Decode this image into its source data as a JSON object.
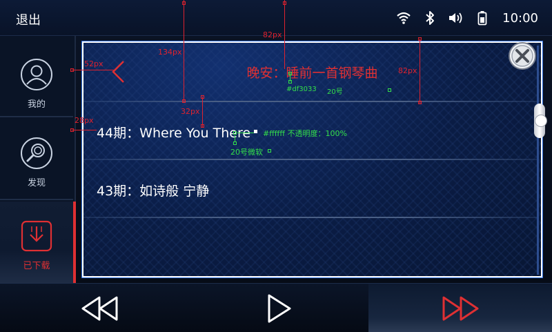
{
  "statusbar": {
    "exit_label": "退出",
    "clock": "10:00",
    "icons": [
      "wifi-icon",
      "bluetooth-icon",
      "volume-icon",
      "battery-icon"
    ]
  },
  "sidebar": {
    "items": [
      {
        "label": "我的",
        "icon": "user-icon"
      },
      {
        "label": "发现",
        "icon": "search-icon"
      },
      {
        "label": "已下载",
        "icon": "download-icon",
        "active": true
      }
    ]
  },
  "panel": {
    "title": "晚安：睡前一首钢琴曲",
    "rows": [
      {
        "label": "44期：Where You There"
      },
      {
        "label": "43期：如诗般 宁静"
      }
    ]
  },
  "annotations": {
    "d52": "52px",
    "d134": "134px",
    "d82a": "82px",
    "d82b": "82px",
    "d32": "32px",
    "d28": "28px",
    "title_color": "#df3033",
    "title_size": "20号",
    "row_spec": "#ffffff 不透明度：100%",
    "row_font": "20号微软"
  },
  "colors": {
    "accent": "#df3033",
    "panel_border": "#ffffff",
    "panel_outline": "#2a6de0",
    "annotation_red": "#e0222e",
    "annotation_green": "#34e04a"
  },
  "bottombar": {
    "controls": [
      "rewind-icon",
      "play-icon",
      "fast-forward-icon"
    ]
  }
}
